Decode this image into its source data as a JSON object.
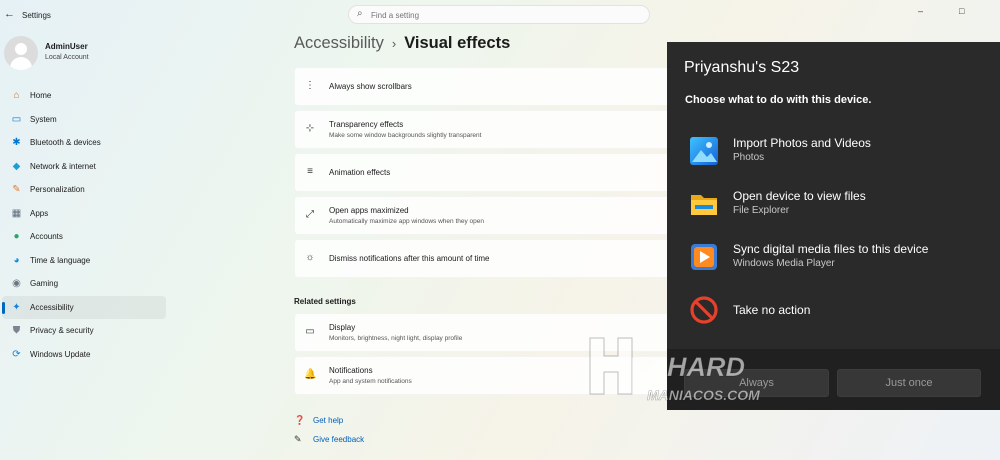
{
  "window": {
    "title": "Settings",
    "back_icon": "arrow-left-icon",
    "minimize": "–",
    "maximize": "□",
    "close": "✕"
  },
  "search": {
    "placeholder": "Find a setting",
    "value": ""
  },
  "user": {
    "name": "AdminUser",
    "type": "Local Account"
  },
  "nav": {
    "items": [
      {
        "label": "Home",
        "icon": "home-icon",
        "color": "#d96a3a"
      },
      {
        "label": "System",
        "icon": "system-icon",
        "color": "#0078d4"
      },
      {
        "label": "Bluetooth & devices",
        "icon": "bluetooth-icon",
        "color": "#0078d4"
      },
      {
        "label": "Network & internet",
        "icon": "wifi-icon",
        "color": "#1aa0d8"
      },
      {
        "label": "Personalization",
        "icon": "brush-icon",
        "color": "#e07b30"
      },
      {
        "label": "Apps",
        "icon": "apps-icon",
        "color": "#5a6b7a"
      },
      {
        "label": "Accounts",
        "icon": "accounts-icon",
        "color": "#2fa36b"
      },
      {
        "label": "Time & language",
        "icon": "globe-clock-icon",
        "color": "#1a8cd8"
      },
      {
        "label": "Gaming",
        "icon": "gamepad-icon",
        "color": "#6b7680"
      },
      {
        "label": "Accessibility",
        "icon": "accessibility-icon",
        "color": "#1a7fd8"
      },
      {
        "label": "Privacy & security",
        "icon": "shield-icon",
        "color": "#7a8590"
      },
      {
        "label": "Windows Update",
        "icon": "update-icon",
        "color": "#1a7fd8"
      }
    ],
    "active": "Accessibility"
  },
  "breadcrumb": {
    "parent": "Accessibility",
    "separator": "›",
    "current": "Visual effects"
  },
  "cards": [
    {
      "title": "Always show scrollbars",
      "subtitle": "",
      "icon": "scrollbar-icon",
      "glyph": "⋮"
    },
    {
      "title": "Transparency effects",
      "subtitle": "Make some window backgrounds slightly transparent",
      "icon": "transparency-icon",
      "glyph": "⊹"
    },
    {
      "title": "Animation effects",
      "subtitle": "",
      "icon": "animation-icon",
      "glyph": "≡"
    },
    {
      "title": "Open apps maximized",
      "subtitle": "Automatically maximize app windows when they open",
      "icon": "maximize-icon",
      "glyph": "⤢"
    },
    {
      "title": "Dismiss notifications after this amount of time",
      "subtitle": "",
      "icon": "brightness-icon",
      "glyph": "☼"
    }
  ],
  "related": {
    "label": "Related settings",
    "cards": [
      {
        "title": "Display",
        "subtitle": "Monitors, brightness, night light, display profile",
        "icon": "monitor-icon",
        "glyph": "▭"
      },
      {
        "title": "Notifications",
        "subtitle": "App and system notifications",
        "icon": "bell-icon",
        "glyph": "🔔"
      }
    ]
  },
  "links": [
    {
      "label": "Get help",
      "icon": "help-icon",
      "glyph": "❓"
    },
    {
      "label": "Give feedback",
      "icon": "feedback-icon",
      "glyph": "✎"
    }
  ],
  "dialog": {
    "title": "Priyanshu's S23",
    "subtitle": "Choose what to do with this device.",
    "options": [
      {
        "label": "Import Photos and Videos",
        "sub": "Photos",
        "icon": "photos-icon"
      },
      {
        "label": "Open device to view files",
        "sub": "File Explorer",
        "icon": "folder-icon"
      },
      {
        "label": "Sync digital media files to this device",
        "sub": "Windows Media Player",
        "icon": "media-player-icon"
      },
      {
        "label": "Take no action",
        "sub": "",
        "icon": "no-action-icon"
      }
    ],
    "buttons": {
      "always": "Always",
      "once": "Just once"
    }
  },
  "watermark": {
    "line1": "HARD",
    "line2": "MANIACOS.COM"
  },
  "colors": {
    "accent": "#0067c0",
    "link": "#005fb8",
    "dialog_bg": "#2a2a2a",
    "no_action_red": "#e8412b"
  }
}
